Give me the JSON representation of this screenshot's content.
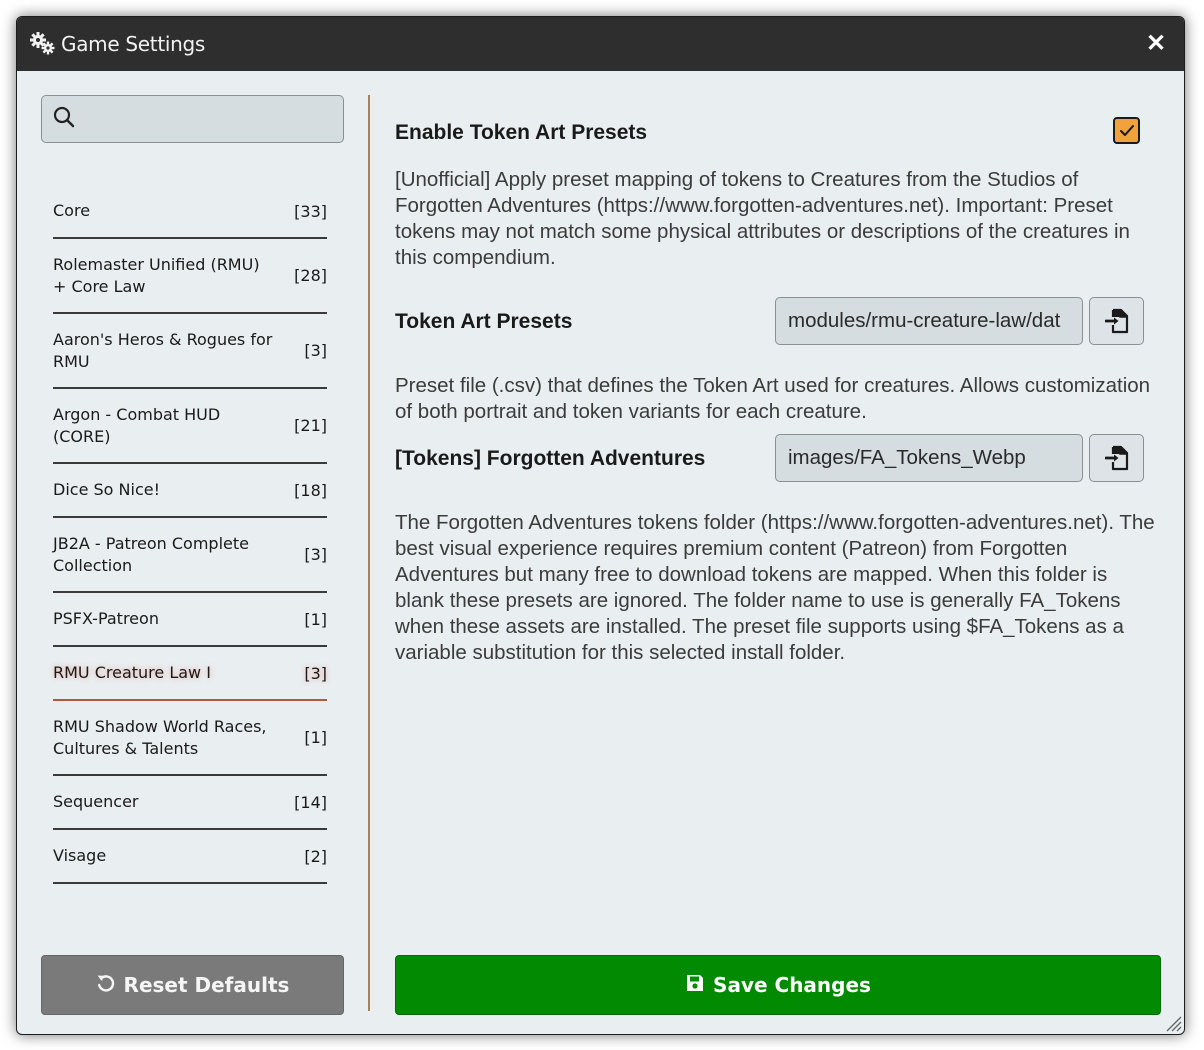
{
  "window": {
    "title": "Game Settings",
    "title_icon": "cogs-icon",
    "close_icon": "close-icon"
  },
  "sidebar": {
    "search": {
      "value": "",
      "placeholder": ""
    },
    "categories": [
      {
        "label": "Core",
        "count": "[33]"
      },
      {
        "label": "Rolemaster Unified (RMU) + Core Law",
        "count": "[28]"
      },
      {
        "label": "Aaron's Heros & Rogues for RMU",
        "count": "[3]"
      },
      {
        "label": "Argon - Combat HUD (CORE)",
        "count": "[21]"
      },
      {
        "label": "Dice So Nice!",
        "count": "[18]"
      },
      {
        "label": "JB2A - Patreon Complete Collection",
        "count": "[3]"
      },
      {
        "label": "PSFX-Patreon",
        "count": "[1]"
      },
      {
        "label": "RMU Creature Law I",
        "count": "[3]"
      },
      {
        "label": "RMU Shadow World Races, Cultures & Talents",
        "count": "[1]"
      },
      {
        "label": "Sequencer",
        "count": "[14]"
      },
      {
        "label": "Visage",
        "count": "[2]"
      }
    ],
    "active_category": "RMU Creature Law I",
    "reset_label": "Reset Defaults"
  },
  "settings": [
    {
      "title": "Enable Token Art Presets",
      "type": "checkbox",
      "checked": true,
      "description": "[Unofficial] Apply preset mapping of tokens to Creatures from the Studios of Forgotten Adventures (https://www.forgotten-adventures.net). Important: Preset tokens may not match some physical attributes or descriptions of the creatures in this compendium."
    },
    {
      "title": "Token Art Presets",
      "type": "file",
      "value": "modules/rmu-creature-law/dat",
      "description": "Preset file (.csv) that defines the Token Art used for creatures. Allows customization of both portrait and token variants for each creature."
    },
    {
      "title": "[Tokens] Forgotten Adventures",
      "type": "file",
      "value": "images/FA_Tokens_Webp",
      "description": "The Forgotten Adventures tokens folder (https://www.forgotten-adventures.net). The best visual experience requires premium content (Patreon) from Forgotten Adventures but many free to download tokens are mapped. When this folder is blank these presets are ignored. The folder name to use is generally FA_Tokens when these assets are installed. The preset file supports using $FA_Tokens as a variable substitution for this selected install folder."
    }
  ],
  "save_label": "Save Changes",
  "colors": {
    "titlebar": "#2e2e2e",
    "background": "#e9eef1",
    "save": "#038a03",
    "reset": "#7a7a7a",
    "checkbox": "#f0a23c",
    "active_underline": "#b5573c"
  }
}
